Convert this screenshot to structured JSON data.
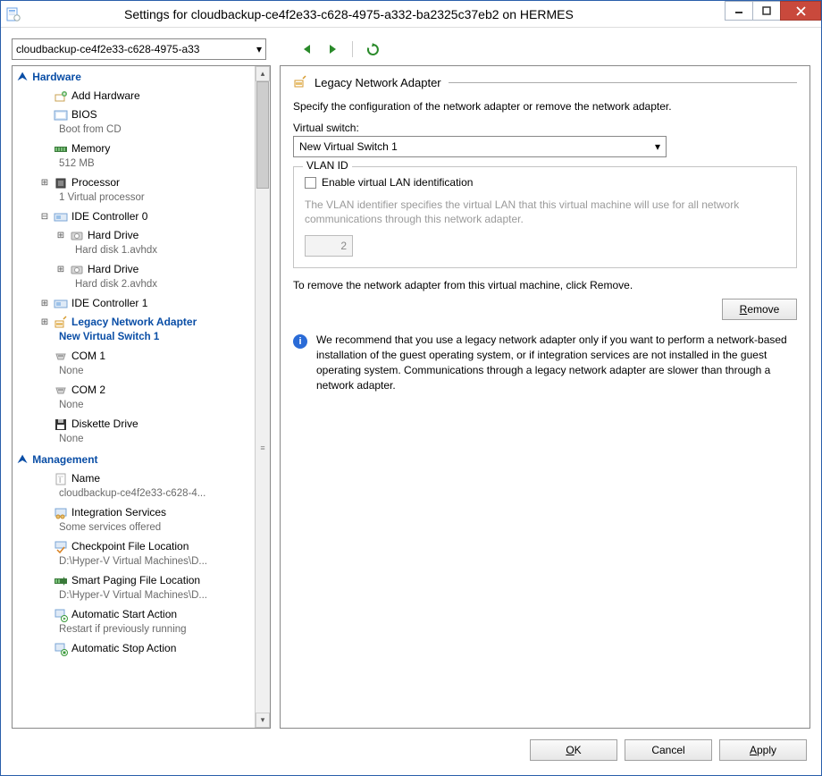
{
  "window": {
    "title": "Settings for cloudbackup-ce4f2e33-c628-4975-a332-ba2325c37eb2 on HERMES"
  },
  "toolbar": {
    "vm_dropdown_value": "cloudbackup-ce4f2e33-c628-4975-a33",
    "prev_label": "Previous",
    "next_label": "Next",
    "refresh_label": "Refresh"
  },
  "tree": {
    "hardware_header": "Hardware",
    "management_header": "Management",
    "items": {
      "add_hw": {
        "label": "Add Hardware"
      },
      "bios": {
        "label": "BIOS",
        "sub": "Boot from CD"
      },
      "memory": {
        "label": "Memory",
        "sub": "512 MB"
      },
      "processor": {
        "label": "Processor",
        "sub": "1 Virtual processor"
      },
      "ide0": {
        "label": "IDE Controller 0"
      },
      "hd1": {
        "label": "Hard Drive",
        "sub": "Hard disk 1.avhdx"
      },
      "hd2": {
        "label": "Hard Drive",
        "sub": "Hard disk 2.avhdx"
      },
      "ide1": {
        "label": "IDE Controller 1"
      },
      "legacy_nic": {
        "label": "Legacy Network Adapter",
        "sub": "New Virtual Switch 1"
      },
      "com1": {
        "label": "COM 1",
        "sub": "None"
      },
      "com2": {
        "label": "COM 2",
        "sub": "None"
      },
      "diskette": {
        "label": "Diskette Drive",
        "sub": "None"
      },
      "name": {
        "label": "Name",
        "sub": "cloudbackup-ce4f2e33-c628-4..."
      },
      "integ": {
        "label": "Integration Services",
        "sub": "Some services offered"
      },
      "checkpoint": {
        "label": "Checkpoint File Location",
        "sub": "D:\\Hyper-V Virtual Machines\\D..."
      },
      "paging": {
        "label": "Smart Paging File Location",
        "sub": "D:\\Hyper-V Virtual Machines\\D..."
      },
      "autostart": {
        "label": "Automatic Start Action",
        "sub": "Restart if previously running"
      },
      "autostop": {
        "label": "Automatic Stop Action"
      }
    }
  },
  "right": {
    "section_title": "Legacy Network Adapter",
    "description": "Specify the configuration of the network adapter or remove the network adapter.",
    "vswitch_label": "Virtual switch:",
    "vswitch_value": "New Virtual Switch 1",
    "vlan_legend": "VLAN ID",
    "vlan_checkbox": "Enable virtual LAN identification",
    "vlan_desc": "The VLAN identifier specifies the virtual LAN that this virtual machine will use for all network communications through this network adapter.",
    "vlan_value": "2",
    "remove_instruction": "To remove the network adapter from this virtual machine, click Remove.",
    "remove_button": "Remove",
    "info_text": "We recommend that you use a legacy network adapter only if you want to perform a network-based installation of the guest operating system, or if integration services are not installed in the guest operating system. Communications through a legacy network adapter are slower than through a network adapter."
  },
  "buttons": {
    "ok": "OK",
    "cancel": "Cancel",
    "apply": "Apply"
  }
}
